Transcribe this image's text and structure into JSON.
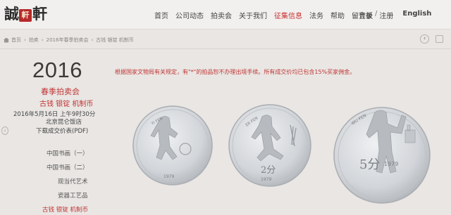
{
  "logo": {
    "left": "誠",
    "seal": "軒",
    "right": "軒"
  },
  "nav": {
    "items": [
      "首页",
      "公司动态",
      "拍卖会",
      "关于我们",
      "征集信息",
      "法务",
      "帮助",
      "留言板"
    ],
    "active_index": 4,
    "login": "登录",
    "register": "注册",
    "separator": "/",
    "language": "English"
  },
  "breadcrumb": {
    "items": [
      "首页",
      "拍卖",
      "2016年春季拍卖会",
      "古钱 银锭 机制币"
    ],
    "back": "‹"
  },
  "auction": {
    "year": "2016",
    "season": "春季拍卖会",
    "category": "古钱 银锭 机制币",
    "date": "2016年5月16日 上午9时30分",
    "venue": "北京昆仑饭店",
    "download": "下载成交价表(PDF)",
    "toggle": "‹"
  },
  "side_menu": {
    "items": [
      "中国书画（一）",
      "中国书画（二）",
      "现当代艺术",
      "瓷器工艺品",
      "古钱 银锭 机制币"
    ]
  },
  "notice": "根据国家文物局有关规定，有\"*\"的拍品恕不办理出境手续。所有成交价均已包含15%买家佣金。",
  "coins": {
    "left": {
      "legend": "YI FEN",
      "year": "1979"
    },
    "middle": {
      "legend": "ER FEN",
      "denomination": "2分",
      "year": "1979"
    },
    "right": {
      "legend": "WU FEN",
      "denomination": "5分",
      "year": "1979"
    }
  },
  "colors": {
    "accent": "#c03535",
    "background": "#e9e6e3",
    "coin": "#d7d9dc"
  }
}
